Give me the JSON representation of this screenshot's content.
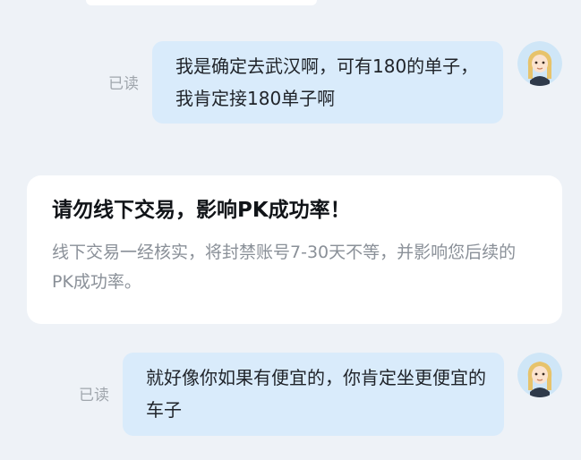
{
  "messages": [
    {
      "text": "我是确定去武汉啊，可有180的单子，我肯定接180单子啊",
      "status": "已读"
    },
    {
      "text": "就好像你如果有便宜的，你肯定坐更便宜的车子",
      "status": "已读"
    }
  ],
  "notice": {
    "title": "请勿线下交易，影响PK成功率！",
    "body": "线下交易一经核实，将封禁账号7-30天不等，并影响您后续的PK成功率。"
  },
  "colors": {
    "background": "#eef2f7",
    "bubble": "#d9ebfb",
    "card": "#ffffff",
    "status_text": "#a0a6ad",
    "notice_body_text": "#8a9098"
  },
  "icons": {
    "avatar": "user-avatar-icon"
  }
}
